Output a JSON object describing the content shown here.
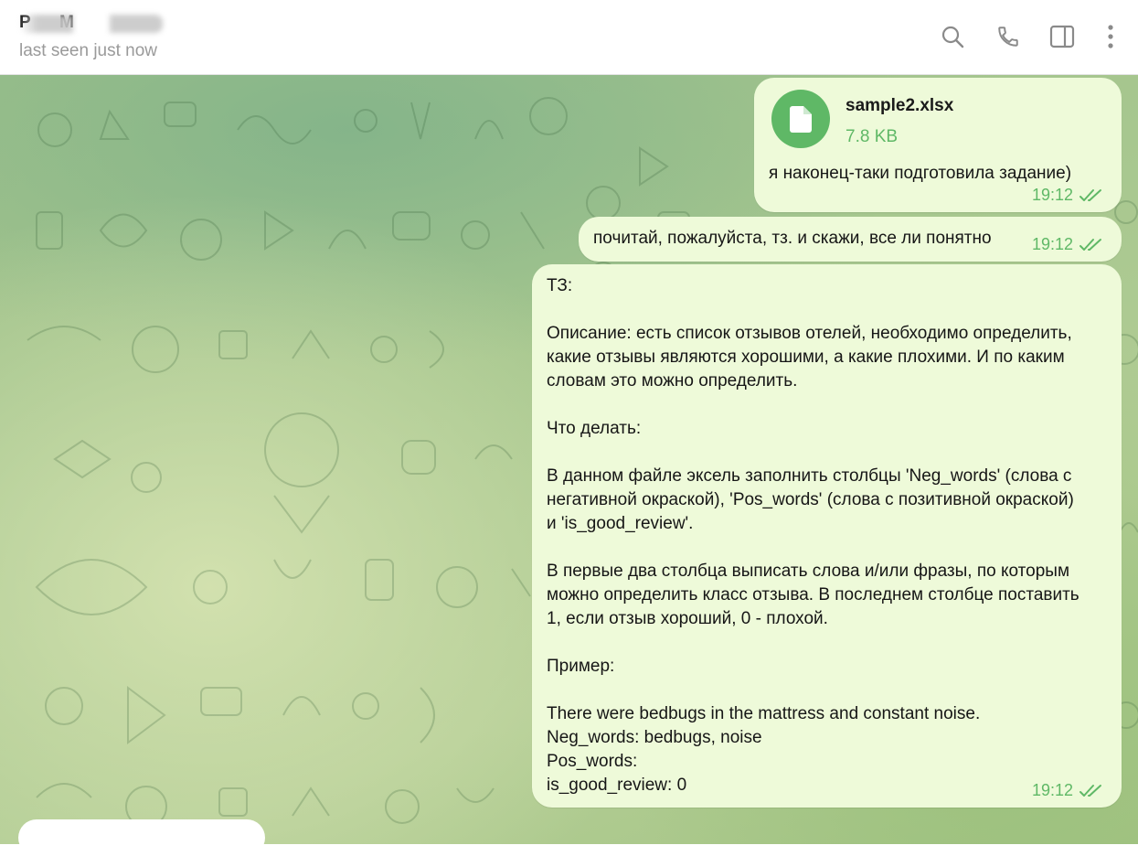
{
  "header": {
    "contact_name": "P      M    ",
    "status": "last seen just now",
    "icons": [
      "search-icon",
      "phone-icon",
      "sidebar-toggle-icon",
      "more-vertical-icon"
    ]
  },
  "messages": [
    {
      "type": "file",
      "file_name": "sample2.xlsx",
      "file_size": "7.8 KB",
      "caption": "я наконец-таки подготовила задание)",
      "time": "19:12",
      "status": "read"
    },
    {
      "type": "text",
      "text": "почитай, пожалуйста, тз. и скажи, все ли понятно",
      "time": "19:12",
      "status": "read"
    },
    {
      "type": "text",
      "text": "ТЗ:\n\nОписание: есть список отзывов отелей, необходимо определить,\nкакие отзывы являются хорошими, а какие плохими. И по каким\nсловам это можно определить.\n\nЧто делать:\n\nВ данном файле эксель заполнить столбцы 'Neg_words' (слова с\nнегативной окраской), 'Pos_words' (слова с позитивной окраской)\nи 'is_good_review'.\n\nВ первые два столбца выписать слова и/или фразы, по которым\nможно определить класс отзыва. В последнем столбце поставить\n1, если отзыв хороший, 0 - плохой.\n\nПример:\n\nThere were bedbugs in the mattress and constant noise.\nNeg_words: bedbugs, noise\nPos_words:\nis_good_review: 0",
      "time": "19:12",
      "status": "read"
    }
  ],
  "colors": {
    "bubble_out": "#eefad9",
    "accent_green": "#5fb866",
    "status_gray": "#9a9a9a"
  }
}
